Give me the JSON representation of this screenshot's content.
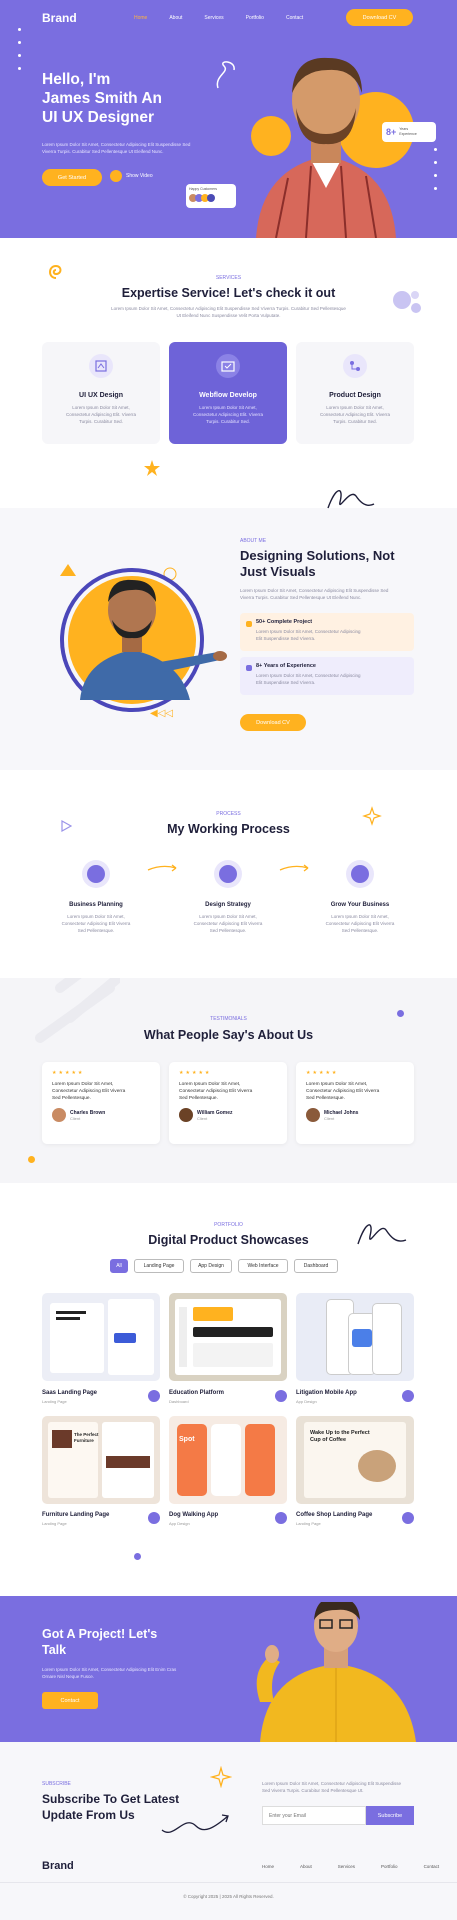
{
  "nav": {
    "brand": "Brand",
    "links": [
      "Home",
      "About",
      "Services",
      "Portfolio",
      "Contact"
    ],
    "cta": "Download CV"
  },
  "hero": {
    "greeting": "Hello, I'm",
    "line2": "James Smith An",
    "line3": "UI UX Designer",
    "desc1": "Lorem Ipsum Dolor Sit Amet, Consectetur Adipiscing Elit Suspendisse Sed",
    "desc2": "Viverra Turpis. Curabitur Sed Pellentesque Ut Eleifend Nunc.",
    "primary_btn": "Get Started",
    "video_label": "Show Video",
    "exp_num": "8+",
    "exp_label1": "Years",
    "exp_label2": "Experience",
    "clients_label": "Happy Customers"
  },
  "services": {
    "tag": "SERVICES",
    "title": "Expertise Service! Let's check it out",
    "desc1": "Lorem Ipsum Dolor Sit Amet, Consectetur Adipiscing Elit Suspendisse Sed Viverra Turpis. Curabitur Sed Pellentesque",
    "desc2": "Ut Eleifend Nunc Suspendisse Velit Porta Vulputate.",
    "items": [
      {
        "title": "UI UX Design",
        "l1": "Lorem Ipsum Dolor Sit Amet,",
        "l2": "Consectetur Adipiscing Elit. Viverra",
        "l3": "Turpis. Curabitur Sed."
      },
      {
        "title": "Webflow Develop",
        "l1": "Lorem Ipsum Dolor Sit Amet,",
        "l2": "Consectetur Adipiscing Elit. Viverra",
        "l3": "Turpis. Curabitur Sed."
      },
      {
        "title": "Product Design",
        "l1": "Lorem Ipsum Dolor Sit Amet,",
        "l2": "Consectetur Adipiscing Elit. Viverra",
        "l3": "Turpis. Curabitur Sed."
      }
    ]
  },
  "about": {
    "tag": "ABOUT ME",
    "title1": "Designing Solutions, Not",
    "title2": "Just Visuals",
    "desc1": "Lorem Ipsum Dolor Sit Amet, Consectetur Adipiscing Elit Suspendisse Sed",
    "desc2": "Viverra Turpis. Curabitur Sed Pellentesque Ut Eleifend Nunc.",
    "feat1_title": "50+ Complete Project",
    "feat1_l1": "Lorem Ipsum Dolor Sit Amet, Consectetur Adipiscing",
    "feat1_l2": "Elit Suspendisse Sed Viverra.",
    "feat2_title": "8+ Years of Experience",
    "feat2_l1": "Lorem Ipsum Dolor Sit Amet, Consectetur Adipiscing",
    "feat2_l2": "Elit Suspendisse Sed Viverra.",
    "btn": "Download CV"
  },
  "process": {
    "tag": "PROCESS",
    "title": "My Working Process",
    "steps": [
      {
        "title": "Business Planning",
        "l1": "Lorem Ipsum Dolor Sit Amet,",
        "l2": "Consectetur Adipiscing Elit Viverra",
        "l3": "Sed Pellentesque."
      },
      {
        "title": "Design Strategy",
        "l1": "Lorem Ipsum Dolor Sit Amet,",
        "l2": "Consectetur Adipiscing Elit Viverra",
        "l3": "Sed Pellentesque."
      },
      {
        "title": "Grow Your Business",
        "l1": "Lorem Ipsum Dolor Sit Amet,",
        "l2": "Consectetur Adipiscing Elit Viverra",
        "l3": "Sed Pellentesque."
      }
    ]
  },
  "testimonials": {
    "tag": "TESTIMONIALS",
    "title": "What People Say's About Us",
    "stars": "★★★★★",
    "items": [
      {
        "l1": "Lorem Ipsum Dolor Sit Amet,",
        "l2": "Consectetur Adipiscing Elit Viverra",
        "l3": "Sed Pellentesque.",
        "name": "Charles Brown",
        "role": "Client"
      },
      {
        "l1": "Lorem Ipsum Dolor Sit Amet,",
        "l2": "Consectetur Adipiscing Elit Viverra",
        "l3": "Sed Pellentesque.",
        "name": "William Gomez",
        "role": "Client"
      },
      {
        "l1": "Lorem Ipsum Dolor Sit Amet,",
        "l2": "Consectetur Adipiscing Elit Viverra",
        "l3": "Sed Pellentesque.",
        "name": "Michael Johns",
        "role": "Client"
      }
    ]
  },
  "portfolio": {
    "tag": "PORTFOLIO",
    "title": "Digital Product Showcases",
    "filters": [
      "All",
      "Landing Page",
      "App Design",
      "Web Interface",
      "Dashboard"
    ],
    "items": [
      {
        "title": "Saas Landing Page",
        "cat": "Landing Page"
      },
      {
        "title": "Education Platform",
        "cat": "Dashboard"
      },
      {
        "title": "Litigation Mobile App",
        "cat": "App Design"
      },
      {
        "title": "Furniture Landing Page",
        "cat": "Landing Page"
      },
      {
        "title": "Dog Walking App",
        "cat": "App Design"
      },
      {
        "title": "Coffee Shop Landing Page",
        "cat": "Landing Page"
      }
    ],
    "coffee_text1": "Wake Up to the Perfect",
    "coffee_text2": "Cup of Coffee",
    "furniture_text1": "The Perfect",
    "furniture_text2": "Furniture",
    "dog_text": "Spot"
  },
  "cta": {
    "title1": "Got A Project! Let's",
    "title2": "Talk",
    "desc1": "Lorem Ipsum Dolor Sit Amet, Consectetur Adipiscing Elit Enim Cras",
    "desc2": "Ornare Nisl Neque Fusce.",
    "btn": "Contact"
  },
  "subscribe": {
    "tag": "SUBSCRIBE",
    "title1": "Subscribe To Get Latest",
    "title2": "Update From Us",
    "desc1": "Lorem Ipsum Dolor Sit Amet, Consectetur Adipiscing Elit Suspendisse",
    "desc2": "Sed Viverra Turpis. Curabitur Sed Pellentesque Ut.",
    "placeholder": "Enter your Email",
    "btn": "Subscribe"
  },
  "footer": {
    "brand": "Brand",
    "links": [
      "Home",
      "About",
      "Services",
      "Portfolio",
      "Contact"
    ],
    "copy": "© Copyright 2025 | 2025 All Rights Reserved."
  },
  "colors": {
    "primary": "#7a6ee0",
    "accent": "#ffb21f"
  }
}
